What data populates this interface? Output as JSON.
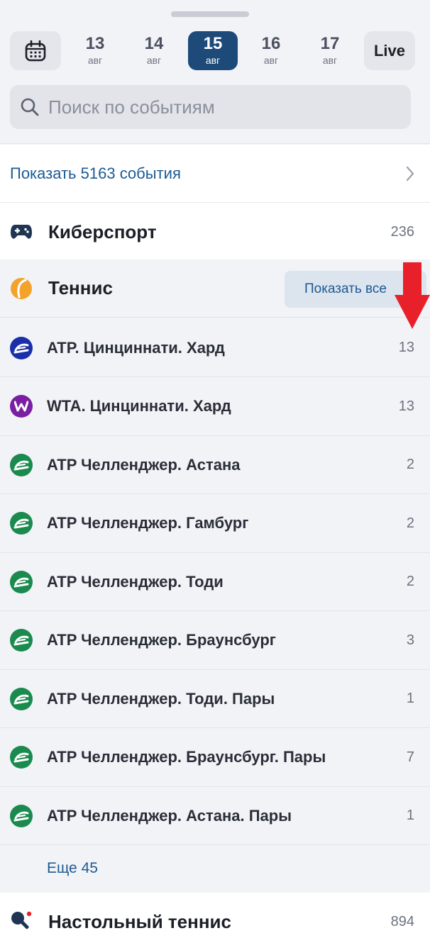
{
  "dates": [
    {
      "day": "13",
      "month": "авг",
      "selected": false
    },
    {
      "day": "14",
      "month": "авг",
      "selected": false
    },
    {
      "day": "15",
      "month": "авг",
      "selected": true
    },
    {
      "day": "16",
      "month": "авг",
      "selected": false
    },
    {
      "day": "17",
      "month": "авг",
      "selected": false
    }
  ],
  "live_label": "Live",
  "search": {
    "placeholder": "Поиск по событиям"
  },
  "show_events": {
    "label": "Показать 5163 события"
  },
  "esports": {
    "name": "Киберспорт",
    "count": "236",
    "icon": "gamepad-icon"
  },
  "tennis": {
    "name": "Теннис",
    "icon": "tennis-ball-icon",
    "show_all_label": "Показать все"
  },
  "leagues": [
    {
      "name": "ATP. Цинциннати. Хард",
      "count": "13",
      "badge": "atp",
      "color": "#1a2fa8"
    },
    {
      "name": "WTA. Цинциннати. Хард",
      "count": "13",
      "badge": "wta",
      "color": "#7a1fa2"
    },
    {
      "name": "ATP Челленджер. Астана",
      "count": "2",
      "badge": "challenger",
      "color": "#1a8a4e"
    },
    {
      "name": "ATP Челленджер. Гамбург",
      "count": "2",
      "badge": "challenger",
      "color": "#1a8a4e"
    },
    {
      "name": "ATP Челленджер. Тоди",
      "count": "2",
      "badge": "challenger",
      "color": "#1a8a4e"
    },
    {
      "name": "ATP Челленджер. Браунсбург",
      "count": "3",
      "badge": "challenger",
      "color": "#1a8a4e"
    },
    {
      "name": "ATP Челленджер. Тоди. Пары",
      "count": "1",
      "badge": "challenger",
      "color": "#1a8a4e"
    },
    {
      "name": "ATP Челленджер. Браунсбург. Пары",
      "count": "7",
      "badge": "challenger",
      "color": "#1a8a4e"
    },
    {
      "name": "ATP Челленджер. Астана. Пары",
      "count": "1",
      "badge": "challenger",
      "color": "#1a8a4e"
    }
  ],
  "more_label": "Еще 45",
  "table_tennis": {
    "name": "Настольный теннис",
    "count": "894",
    "icon": "table-tennis-icon"
  },
  "colors": {
    "accent": "#1d4a78",
    "link": "#1d5a94",
    "annotation_arrow": "#e8202a"
  }
}
